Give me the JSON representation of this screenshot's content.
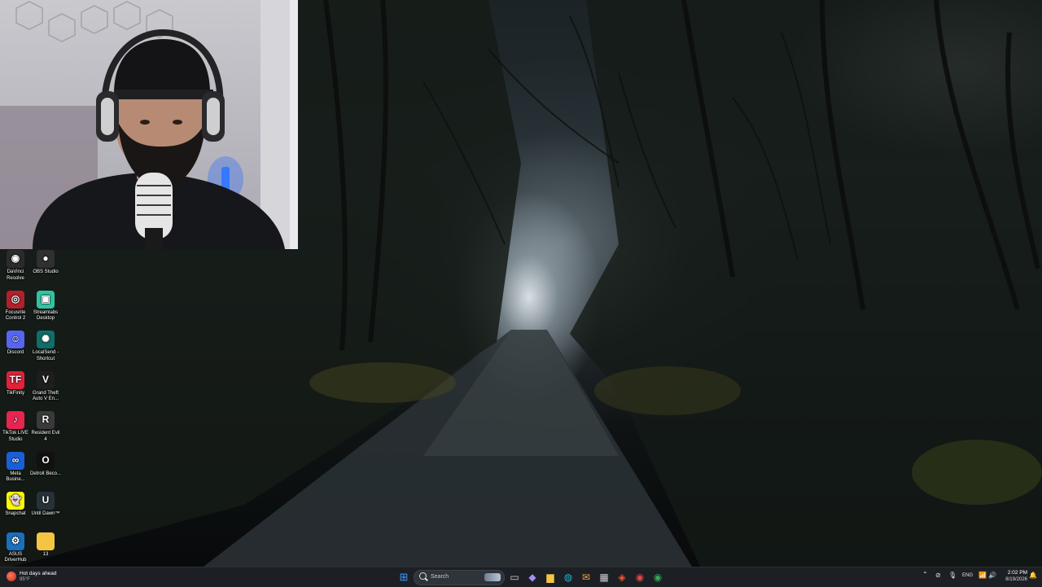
{
  "desktop": {
    "icons": [
      {
        "label": "DaVinci Resolve",
        "glyph": "◉",
        "bg": "#2b2b2b",
        "icon": "davinci-resolve-icon"
      },
      {
        "label": "OBS Studio",
        "glyph": "●",
        "bg": "#303030",
        "icon": "obs-studio-icon"
      },
      {
        "label": "Focusrite Control 2",
        "glyph": "◎",
        "bg": "#b3202a",
        "icon": "focusrite-icon"
      },
      {
        "label": "Streamlabs Desktop",
        "glyph": "▣",
        "bg": "#31c3a2",
        "icon": "streamlabs-icon"
      },
      {
        "label": "Discord",
        "glyph": "☺",
        "bg": "#5865f2",
        "icon": "discord-icon"
      },
      {
        "label": "LocalSend - Shortcut",
        "glyph": "✺",
        "bg": "#0f6e6a",
        "icon": "localsend-icon"
      },
      {
        "label": "TikFinity",
        "glyph": "TF",
        "bg": "#e3213b",
        "icon": "tikfinity-icon"
      },
      {
        "label": "Grand Theft Auto V En...",
        "glyph": "V",
        "bg": "#1e1e1e",
        "icon": "gta-v-icon"
      },
      {
        "label": "TikTok LIVE Studio",
        "glyph": "♪",
        "bg": "#e7254f",
        "icon": "tiktok-live-icon"
      },
      {
        "label": "Resident Evil 4",
        "glyph": "R",
        "bg": "#3a3a3a",
        "icon": "resident-evil-icon"
      },
      {
        "label": "Meta Busine...",
        "glyph": "∞",
        "bg": "#1a5fd8",
        "icon": "meta-business-icon"
      },
      {
        "label": "Detroit Beco...",
        "glyph": "O",
        "bg": "#111",
        "icon": "detroit-icon"
      },
      {
        "label": "Snapchat",
        "glyph": "👻",
        "bg": "#fffc00",
        "icon": "snapchat-icon"
      },
      {
        "label": "Until Dawn™",
        "glyph": "U",
        "bg": "#263238",
        "icon": "until-dawn-icon"
      },
      {
        "label": "ASUS DriverHub",
        "glyph": "⚙",
        "bg": "#1b6fbf",
        "icon": "asus-driverhub-icon"
      },
      {
        "label": "13",
        "glyph": "",
        "bg": "#f4c542",
        "icon": "folder-icon"
      }
    ]
  },
  "taskbar": {
    "weather": {
      "title": "Hot days ahead",
      "temp": "95°F"
    },
    "search_placeholder": "Search",
    "apps": [
      {
        "name": "start",
        "glyph": "⊞",
        "color": "#3aa0ff"
      },
      {
        "name": "task-view",
        "glyph": "▭",
        "color": "#cfd3d8"
      },
      {
        "name": "copilot",
        "glyph": "◆",
        "color": "#a78bfa"
      },
      {
        "name": "file-explorer",
        "glyph": "▆",
        "color": "#f4c542"
      },
      {
        "name": "edge",
        "glyph": "◍",
        "color": "#1fb3c9"
      },
      {
        "name": "mail",
        "glyph": "✉",
        "color": "#f0a13b"
      },
      {
        "name": "store",
        "glyph": "▦",
        "color": "#cfd3d8"
      },
      {
        "name": "brave",
        "glyph": "◈",
        "color": "#fb542b"
      },
      {
        "name": "screen-recorder",
        "glyph": "◉",
        "color": "#e04848"
      },
      {
        "name": "chrome",
        "glyph": "◉",
        "color": "#34a853"
      }
    ],
    "tray": {
      "language": "ENG",
      "time": "2:02 PM",
      "date": "8/19/2026"
    }
  }
}
